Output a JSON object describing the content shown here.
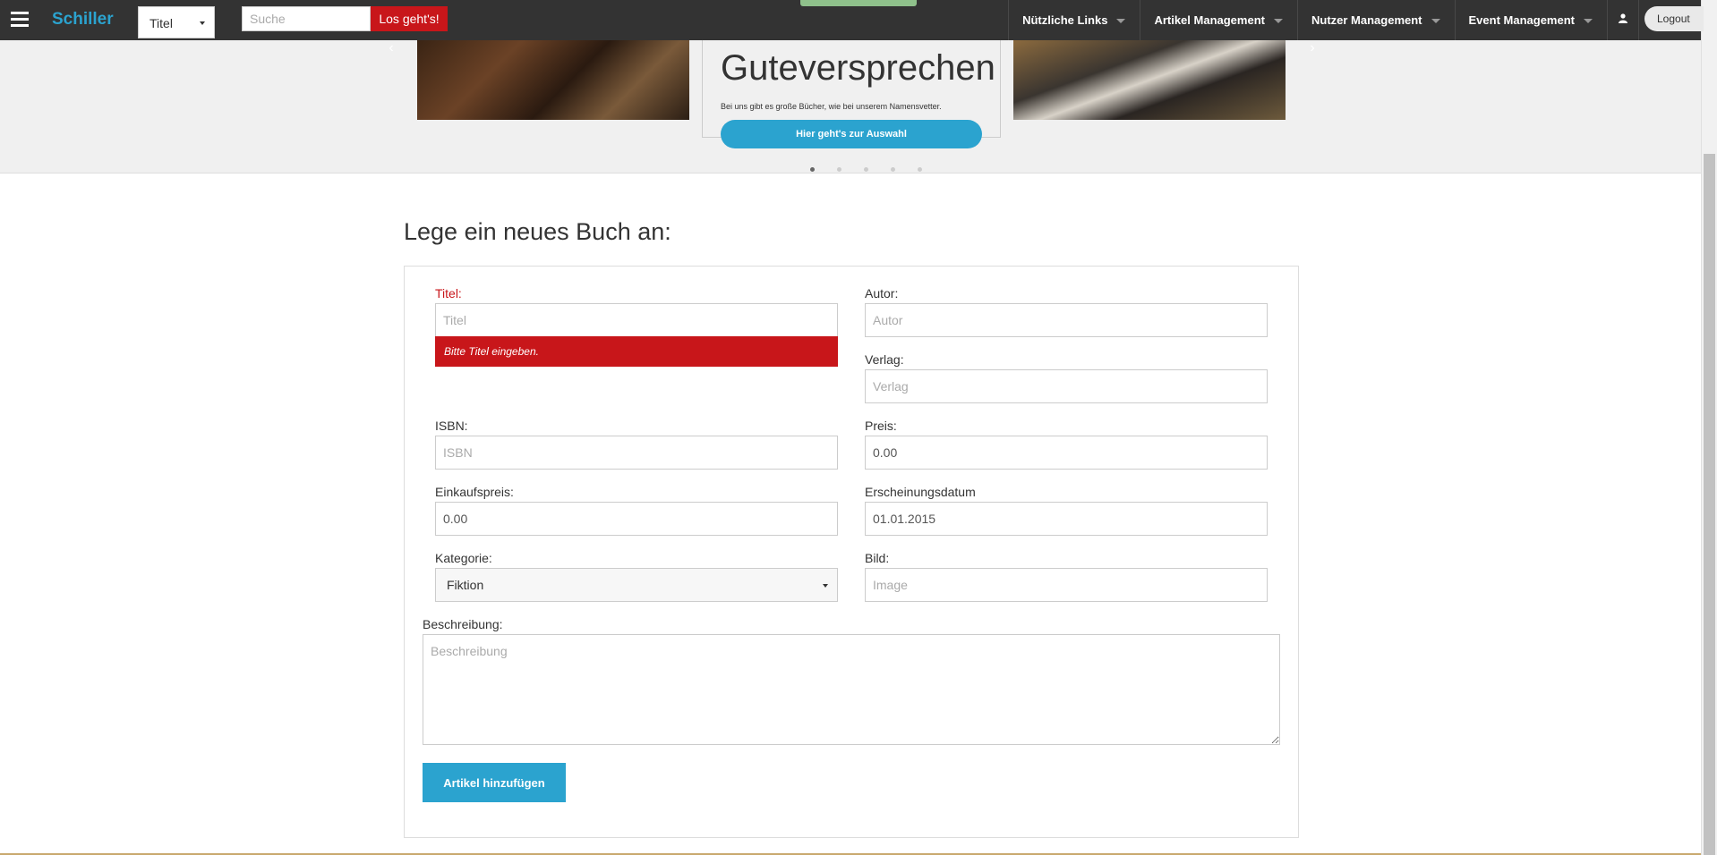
{
  "header": {
    "brand": "Schiller",
    "search_type": "Titel",
    "search_placeholder": "Suche",
    "search_button": "Los geht's!",
    "nav": [
      {
        "label": "Nützliche Links"
      },
      {
        "label": "Artikel Management"
      },
      {
        "label": "Nutzer Management"
      },
      {
        "label": "Event Management"
      }
    ],
    "user_icon": "user-icon",
    "logout": "Logout"
  },
  "carousel": {
    "slide_title": "Guteversprechen",
    "slide_text": "Bei uns gibt es große Bücher, wie bei unserem Namensvetter.",
    "slide_button": "Hier geht's zur Auswahl",
    "prev_icon": "‹",
    "next_icon": "›",
    "slide_count": 5,
    "active_slide": 1
  },
  "form": {
    "page_title": "Lege ein neues Buch an:",
    "title": {
      "label": "Titel:",
      "placeholder": "Titel",
      "value": "",
      "error": "Bitte Titel eingeben."
    },
    "author": {
      "label": "Autor:",
      "placeholder": "Autor",
      "value": ""
    },
    "publisher": {
      "label": "Verlag:",
      "placeholder": "Verlag",
      "value": ""
    },
    "isbn": {
      "label": "ISBN:",
      "placeholder": "ISBN",
      "value": ""
    },
    "price": {
      "label": "Preis:",
      "placeholder": "",
      "value": "0.00"
    },
    "purchase_price": {
      "label": "Einkaufspreis:",
      "placeholder": "",
      "value": "0.00"
    },
    "release_date": {
      "label": "Erscheinungsdatum",
      "placeholder": "",
      "value": "01.01.2015"
    },
    "category": {
      "label": "Kategorie:",
      "value": "Fiktion"
    },
    "image": {
      "label": "Bild:",
      "placeholder": "Image",
      "value": ""
    },
    "description": {
      "label": "Beschreibung:",
      "placeholder": "Beschreibung",
      "value": ""
    },
    "submit": "Artikel hinzufügen"
  },
  "colors": {
    "accent": "#2ba3cf",
    "error": "#c8161a",
    "navbar": "#333333"
  }
}
